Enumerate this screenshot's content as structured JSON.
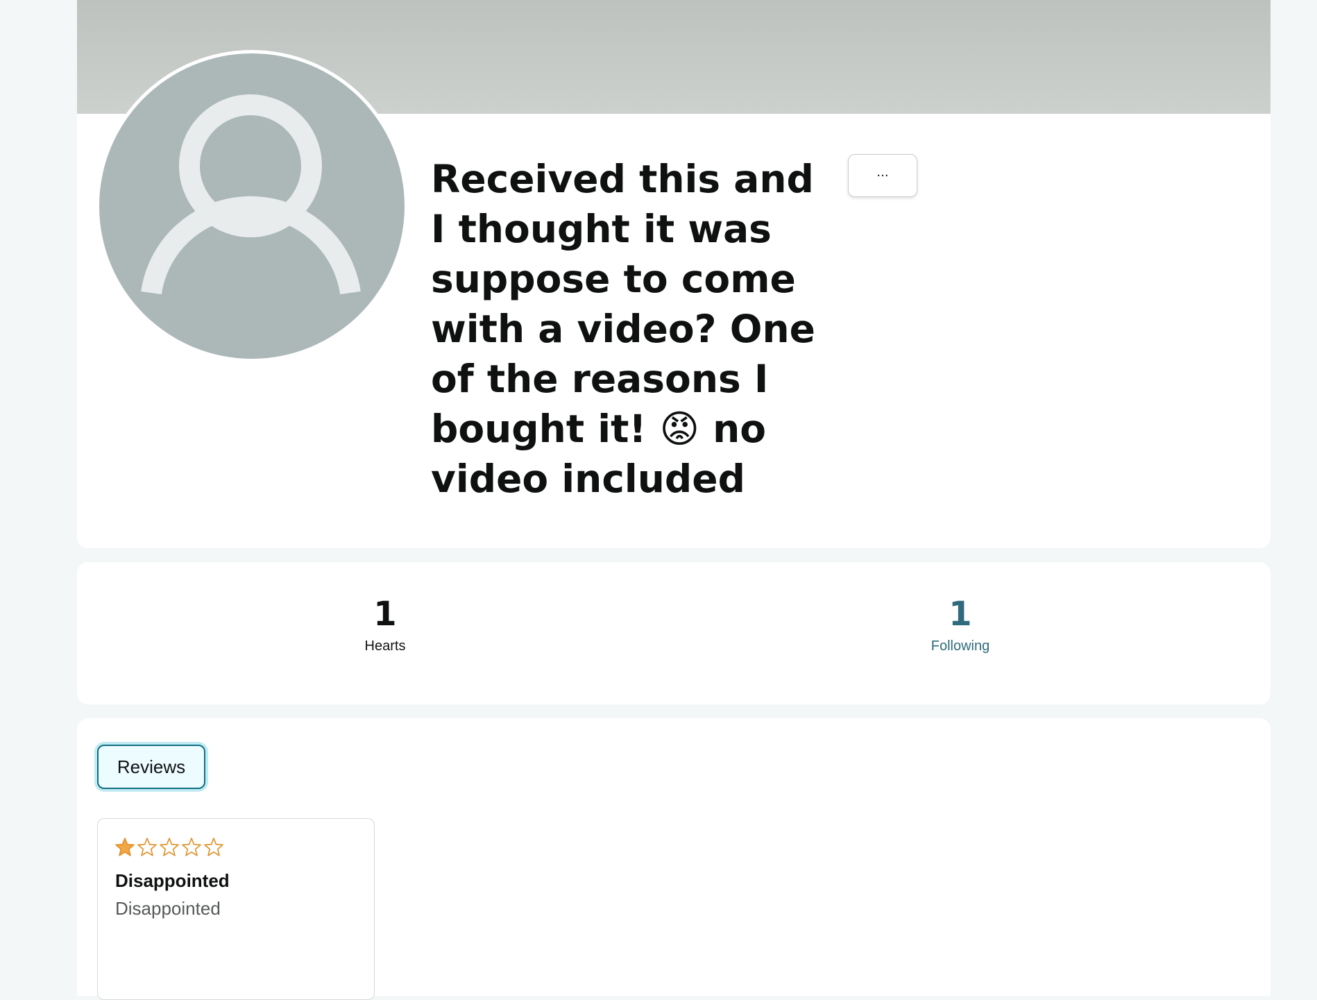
{
  "profile": {
    "name": "Received this and I thought it was suppose to come with a video? One of the reasons I bought it! 😡 no video included",
    "more_label": "...",
    "avatar_icon": "default-user-avatar-icon"
  },
  "stats": {
    "hearts": {
      "value": "1",
      "label": "Hearts"
    },
    "following": {
      "value": "1",
      "label": "Following"
    }
  },
  "tabs": [
    {
      "label": "Reviews",
      "active": true
    }
  ],
  "reviews": [
    {
      "rating": 1,
      "max_rating": 5,
      "title": "Disappointed",
      "body": "Disappointed"
    }
  ],
  "colors": {
    "page_bg": "#f3f7f8",
    "banner": "#c4c8c5",
    "avatar_bg": "#acb7b8",
    "avatar_fg": "#e9ecec",
    "link_teal": "#2f6b7c",
    "star_fill": "#f3a847",
    "star_outline": "#e08e24"
  }
}
